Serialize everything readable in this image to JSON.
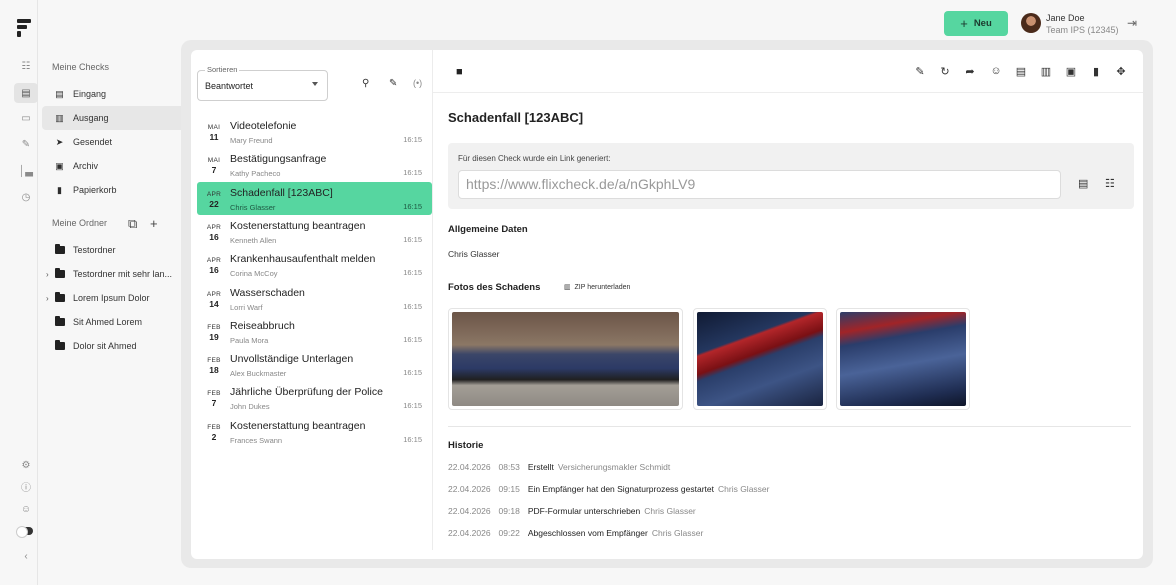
{
  "header": {
    "new_button": "Neu",
    "user_name": "Jane Doe",
    "user_team": "Team IPS (12345)"
  },
  "sidebar": {
    "section_checks": "Meine Checks",
    "nav": [
      {
        "label": "Eingang",
        "icon": "inbox-icon"
      },
      {
        "label": "Ausgang",
        "icon": "outbox-icon"
      },
      {
        "label": "Gesendet",
        "icon": "send-icon"
      },
      {
        "label": "Archiv",
        "icon": "archive-icon"
      },
      {
        "label": "Papierkorb",
        "icon": "trash-icon"
      }
    ],
    "section_folders": "Meine Ordner",
    "folders": [
      {
        "label": "Testordner",
        "expandable": false
      },
      {
        "label": "Testordner mit sehr lan...",
        "expandable": true
      },
      {
        "label": "Lorem Ipsum Dolor",
        "expandable": true
      },
      {
        "label": "Sit Ahmed Lorem",
        "expandable": false
      },
      {
        "label": "Dolor sit Ahmed",
        "expandable": false
      }
    ]
  },
  "list": {
    "sort_label": "Sortieren",
    "sort_value": "Beantwortet",
    "items": [
      {
        "mon": "MAI",
        "day": "11",
        "title": "Videotelefonie",
        "person": "Mary Freund",
        "time": "16:15"
      },
      {
        "mon": "MAI",
        "day": "7",
        "title": "Bestätigungsanfrage",
        "person": "Kathy Pacheco",
        "time": "16:15"
      },
      {
        "mon": "APR",
        "day": "22",
        "title": "Schadenfall [123ABC]",
        "person": "Chris Glasser",
        "time": "16:15"
      },
      {
        "mon": "APR",
        "day": "16",
        "title": "Kostenerstattung beantragen",
        "person": "Kenneth Allen",
        "time": "16:15"
      },
      {
        "mon": "APR",
        "day": "16",
        "title": "Krankenhausaufenthalt melden",
        "person": "Corina McCoy",
        "time": "16:15"
      },
      {
        "mon": "APR",
        "day": "14",
        "title": "Wasserschaden",
        "person": "Lorri Warf",
        "time": "16:15"
      },
      {
        "mon": "FEB",
        "day": "19",
        "title": "Reiseabbruch",
        "person": "Paula Mora",
        "time": "16:15"
      },
      {
        "mon": "FEB",
        "day": "18",
        "title": "Unvollständige Unterlagen",
        "person": "Alex Buckmaster",
        "time": "16:15"
      },
      {
        "mon": "FEB",
        "day": "7",
        "title": "Jährliche Überprüfung der Police",
        "person": "John Dukes",
        "time": "16:15"
      },
      {
        "mon": "FEB",
        "day": "2",
        "title": "Kostenerstattung beantragen",
        "person": "Frances Swann",
        "time": "16:15"
      }
    ]
  },
  "detail": {
    "title": "Schadenfall [123ABC]",
    "link_notice": "Für diesen Check wurde ein Link generiert:",
    "link_url": "https://www.flixcheck.de/a/nGkphLV9",
    "general_heading": "Allgemeine Daten",
    "general_value": "Chris Glasser",
    "photos_heading": "Fotos des Schadens",
    "zip_label": "ZIP herunterladen",
    "history_heading": "Historie",
    "history": [
      {
        "date": "22.04.2026",
        "time": "08:53",
        "event": "Erstellt",
        "who": "Versicherungsmakler Schmidt"
      },
      {
        "date": "22.04.2026",
        "time": "09:15",
        "event": "Ein Empfänger hat den Signaturprozess gestartet",
        "who": "Chris Glasser"
      },
      {
        "date": "22.04.2026",
        "time": "09:18",
        "event": "PDF-Formular unterschrieben",
        "who": "Chris Glasser"
      },
      {
        "date": "22.04.2026",
        "time": "09:22",
        "event": "Abgeschlossen vom Empfänger",
        "who": "Chris Glasser"
      }
    ]
  },
  "colors": {
    "accent": "#56d6a0",
    "background": "#f7f7f7",
    "panel": "#ffffff"
  }
}
